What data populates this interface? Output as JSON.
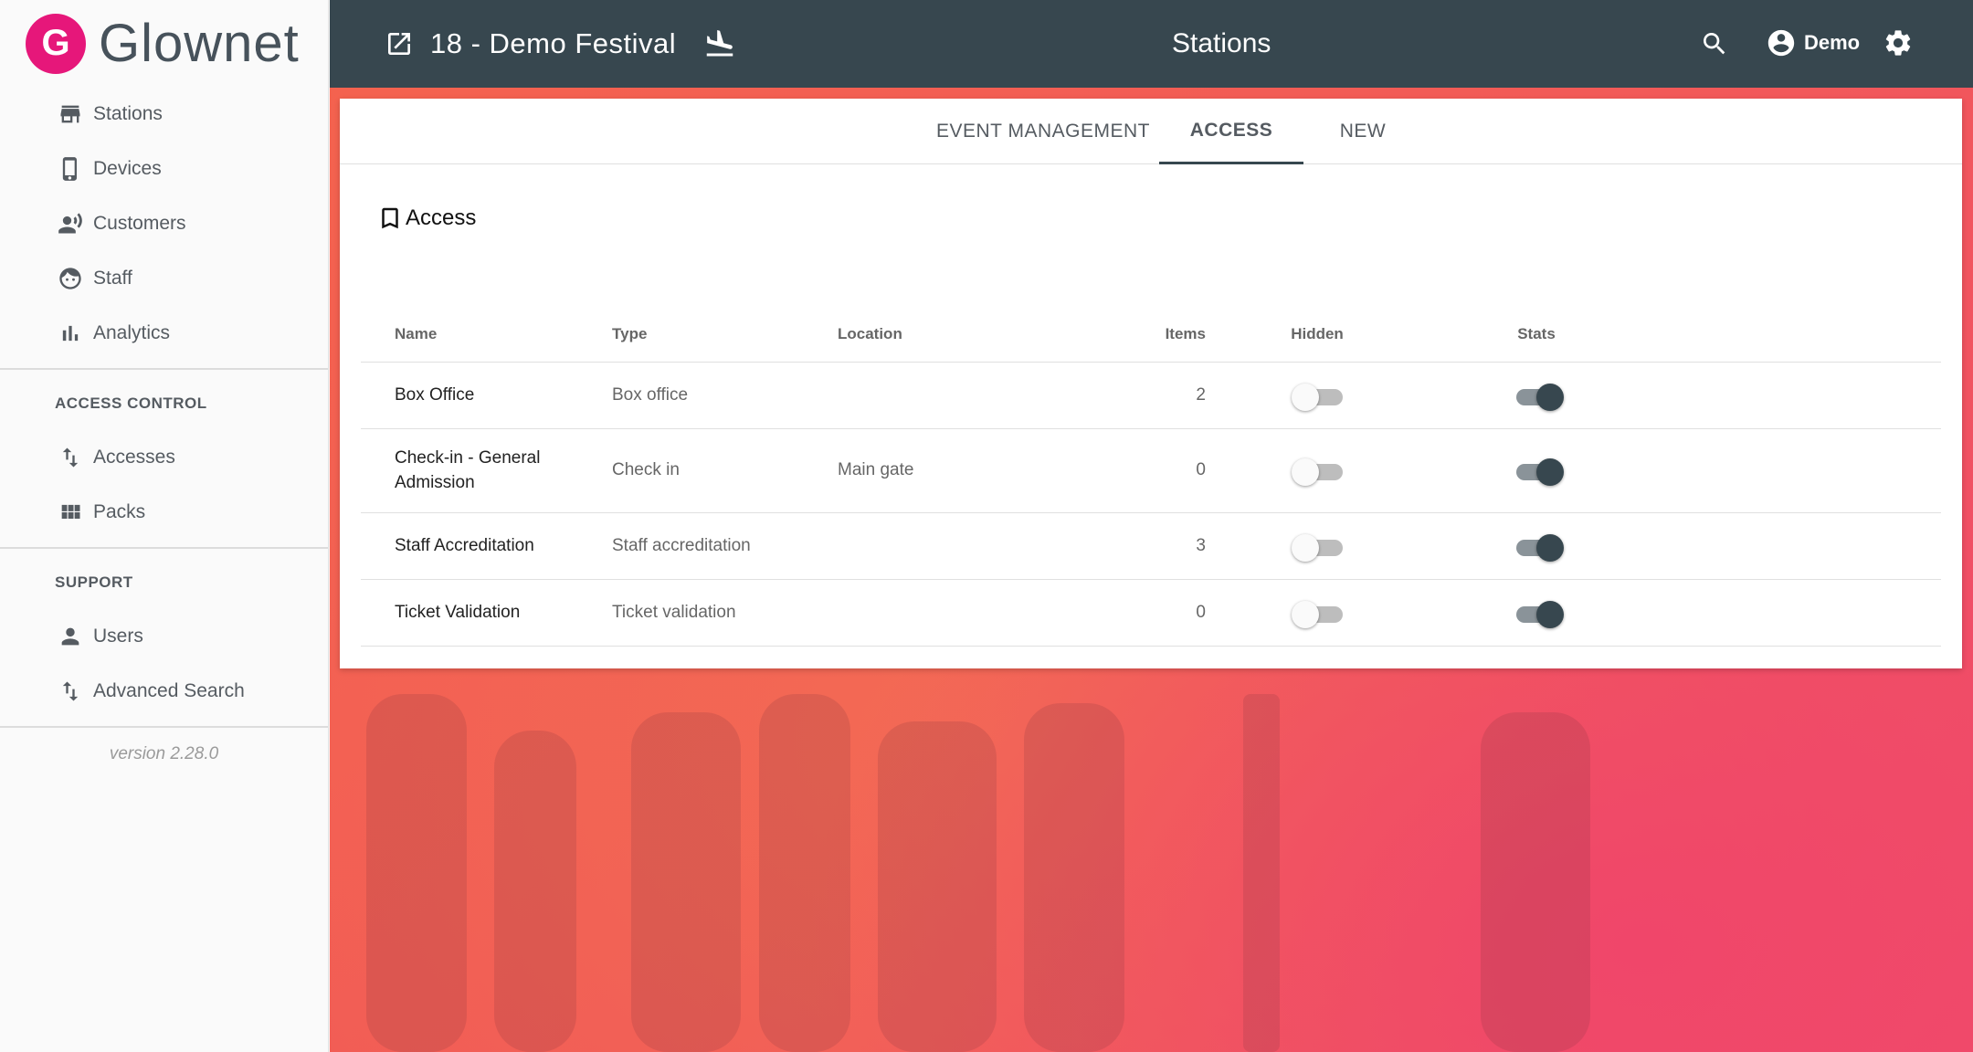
{
  "brand": {
    "logo_letter": "G",
    "name": "Glownet"
  },
  "sidebar": {
    "items": [
      {
        "label": "Stations",
        "icon": "store-icon"
      },
      {
        "label": "Devices",
        "icon": "phone-icon"
      },
      {
        "label": "Customers",
        "icon": "customers-icon"
      },
      {
        "label": "Staff",
        "icon": "face-icon"
      },
      {
        "label": "Analytics",
        "icon": "bar-chart-icon"
      }
    ],
    "access_control_label": "ACCESS CONTROL",
    "access_items": [
      {
        "label": "Accesses",
        "icon": "swap-vertical-icon"
      },
      {
        "label": "Packs",
        "icon": "grid-icon"
      }
    ],
    "support_label": "SUPPORT",
    "support_items": [
      {
        "label": "Users",
        "icon": "person-icon"
      },
      {
        "label": "Advanced Search",
        "icon": "swap-vertical-icon"
      }
    ],
    "version": "version 2.28.0"
  },
  "header": {
    "event_title": "18 - Demo Festival",
    "page_title": "Stations",
    "user_name": "Demo",
    "bg_color": "#37474f"
  },
  "tabs": [
    {
      "label": "EVENT MANAGEMENT",
      "active": false
    },
    {
      "label": "ACCESS",
      "active": true
    },
    {
      "label": "NEW",
      "active": false
    }
  ],
  "card_title": "Access",
  "table": {
    "columns": [
      "Name",
      "Type",
      "Location",
      "Items",
      "Hidden",
      "Stats"
    ],
    "rows": [
      {
        "name": "Box Office",
        "type": "Box office",
        "location": "",
        "items": "2",
        "hidden": false,
        "stats": true
      },
      {
        "name": "Check-in - General Admission",
        "type": "Check in",
        "location": "Main gate",
        "items": "0",
        "hidden": false,
        "stats": true
      },
      {
        "name": "Staff Accreditation",
        "type": "Staff accreditation",
        "location": "",
        "items": "3",
        "hidden": false,
        "stats": true
      },
      {
        "name": "Ticket Validation",
        "type": "Ticket validation",
        "location": "",
        "items": "0",
        "hidden": false,
        "stats": true
      }
    ]
  },
  "colors": {
    "accent": "#e6177a",
    "header": "#37474f",
    "background": "#f25a57"
  }
}
